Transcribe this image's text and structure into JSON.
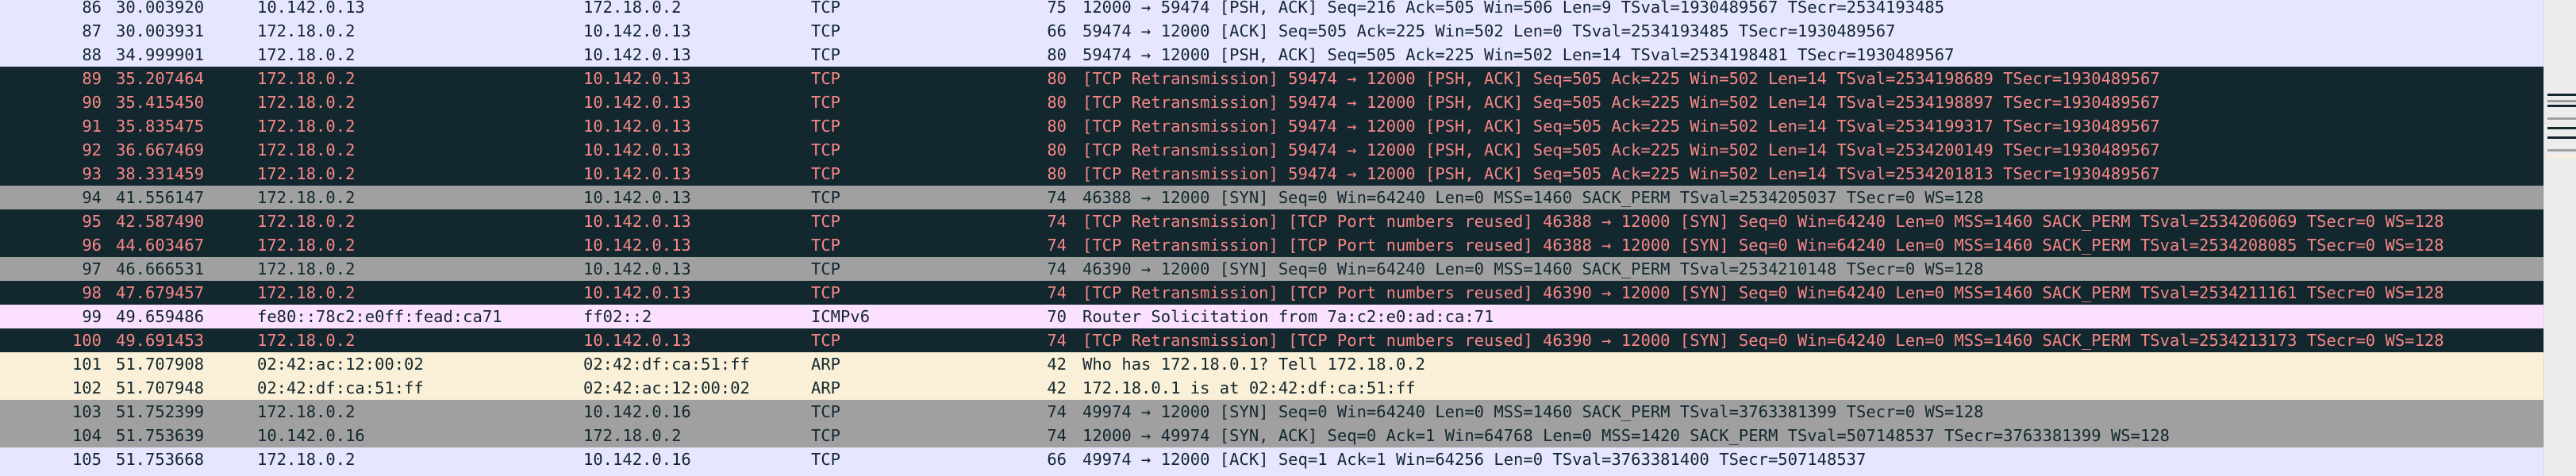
{
  "packets": [
    {
      "no": "86",
      "time": "30.003920",
      "src": "10.142.0.13",
      "dst": "172.18.0.2",
      "proto": "TCP",
      "len": "75",
      "info": "12000 → 59474 [PSH, ACK] Seq=216 Ack=505 Win=506 Len=9 TSval=1930489567 TSecr=2534193485",
      "style": "tcp"
    },
    {
      "no": "87",
      "time": "30.003931",
      "src": "172.18.0.2",
      "dst": "10.142.0.13",
      "proto": "TCP",
      "len": "66",
      "info": "59474 → 12000 [ACK] Seq=505 Ack=225 Win=502 Len=0 TSval=2534193485 TSecr=1930489567",
      "style": "tcp"
    },
    {
      "no": "88",
      "time": "34.999901",
      "src": "172.18.0.2",
      "dst": "10.142.0.13",
      "proto": "TCP",
      "len": "80",
      "info": "59474 → 12000 [PSH, ACK] Seq=505 Ack=225 Win=502 Len=14 TSval=2534198481 TSecr=1930489567",
      "style": "tcp"
    },
    {
      "no": "89",
      "time": "35.207464",
      "src": "172.18.0.2",
      "dst": "10.142.0.13",
      "proto": "TCP",
      "len": "80",
      "info": "[TCP Retransmission] 59474 → 12000 [PSH, ACK] Seq=505 Ack=225 Win=502 Len=14 TSval=2534198689 TSecr=1930489567",
      "style": "bad"
    },
    {
      "no": "90",
      "time": "35.415450",
      "src": "172.18.0.2",
      "dst": "10.142.0.13",
      "proto": "TCP",
      "len": "80",
      "info": "[TCP Retransmission] 59474 → 12000 [PSH, ACK] Seq=505 Ack=225 Win=502 Len=14 TSval=2534198897 TSecr=1930489567",
      "style": "bad"
    },
    {
      "no": "91",
      "time": "35.835475",
      "src": "172.18.0.2",
      "dst": "10.142.0.13",
      "proto": "TCP",
      "len": "80",
      "info": "[TCP Retransmission] 59474 → 12000 [PSH, ACK] Seq=505 Ack=225 Win=502 Len=14 TSval=2534199317 TSecr=1930489567",
      "style": "bad"
    },
    {
      "no": "92",
      "time": "36.667469",
      "src": "172.18.0.2",
      "dst": "10.142.0.13",
      "proto": "TCP",
      "len": "80",
      "info": "[TCP Retransmission] 59474 → 12000 [PSH, ACK] Seq=505 Ack=225 Win=502 Len=14 TSval=2534200149 TSecr=1930489567",
      "style": "bad"
    },
    {
      "no": "93",
      "time": "38.331459",
      "src": "172.18.0.2",
      "dst": "10.142.0.13",
      "proto": "TCP",
      "len": "80",
      "info": "[TCP Retransmission] 59474 → 12000 [PSH, ACK] Seq=505 Ack=225 Win=502 Len=14 TSval=2534201813 TSecr=1930489567",
      "style": "bad"
    },
    {
      "no": "94",
      "time": "41.556147",
      "src": "172.18.0.2",
      "dst": "10.142.0.13",
      "proto": "TCP",
      "len": "74",
      "info": "46388 → 12000 [SYN] Seq=0 Win=64240 Len=0 MSS=1460 SACK_PERM TSval=2534205037 TSecr=0 WS=128",
      "style": "gray"
    },
    {
      "no": "95",
      "time": "42.587490",
      "src": "172.18.0.2",
      "dst": "10.142.0.13",
      "proto": "TCP",
      "len": "74",
      "info": "[TCP Retransmission] [TCP Port numbers reused] 46388 → 12000 [SYN] Seq=0 Win=64240 Len=0 MSS=1460 SACK_PERM TSval=2534206069 TSecr=0 WS=128",
      "style": "bad"
    },
    {
      "no": "96",
      "time": "44.603467",
      "src": "172.18.0.2",
      "dst": "10.142.0.13",
      "proto": "TCP",
      "len": "74",
      "info": "[TCP Retransmission] [TCP Port numbers reused] 46388 → 12000 [SYN] Seq=0 Win=64240 Len=0 MSS=1460 SACK_PERM TSval=2534208085 TSecr=0 WS=128",
      "style": "bad"
    },
    {
      "no": "97",
      "time": "46.666531",
      "src": "172.18.0.2",
      "dst": "10.142.0.13",
      "proto": "TCP",
      "len": "74",
      "info": "46390 → 12000 [SYN] Seq=0 Win=64240 Len=0 MSS=1460 SACK_PERM TSval=2534210148 TSecr=0 WS=128",
      "style": "gray"
    },
    {
      "no": "98",
      "time": "47.679457",
      "src": "172.18.0.2",
      "dst": "10.142.0.13",
      "proto": "TCP",
      "len": "74",
      "info": "[TCP Retransmission] [TCP Port numbers reused] 46390 → 12000 [SYN] Seq=0 Win=64240 Len=0 MSS=1460 SACK_PERM TSval=2534211161 TSecr=0 WS=128",
      "style": "bad"
    },
    {
      "no": "99",
      "time": "49.659486",
      "src": "fe80::78c2:e0ff:fead:ca71",
      "dst": "ff02::2",
      "proto": "ICMPv6",
      "len": "70",
      "info": "Router Solicitation from 7a:c2:e0:ad:ca:71",
      "style": "icmp"
    },
    {
      "no": "100",
      "time": "49.691453",
      "src": "172.18.0.2",
      "dst": "10.142.0.13",
      "proto": "TCP",
      "len": "74",
      "info": "[TCP Retransmission] [TCP Port numbers reused] 46390 → 12000 [SYN] Seq=0 Win=64240 Len=0 MSS=1460 SACK_PERM TSval=2534213173 TSecr=0 WS=128",
      "style": "bad"
    },
    {
      "no": "101",
      "time": "51.707908",
      "src": "02:42:ac:12:00:02",
      "dst": "02:42:df:ca:51:ff",
      "proto": "ARP",
      "len": "42",
      "info": "Who has 172.18.0.1? Tell 172.18.0.2",
      "style": "arp"
    },
    {
      "no": "102",
      "time": "51.707948",
      "src": "02:42:df:ca:51:ff",
      "dst": "02:42:ac:12:00:02",
      "proto": "ARP",
      "len": "42",
      "info": "172.18.0.1 is at 02:42:df:ca:51:ff",
      "style": "arp"
    },
    {
      "no": "103",
      "time": "51.752399",
      "src": "172.18.0.2",
      "dst": "10.142.0.16",
      "proto": "TCP",
      "len": "74",
      "info": "49974 → 12000 [SYN] Seq=0 Win=64240 Len=0 MSS=1460 SACK_PERM TSval=3763381399 TSecr=0 WS=128",
      "style": "gray"
    },
    {
      "no": "104",
      "time": "51.753639",
      "src": "10.142.0.16",
      "dst": "172.18.0.2",
      "proto": "TCP",
      "len": "74",
      "info": "12000 → 49974 [SYN, ACK] Seq=0 Ack=1 Win=64768 Len=0 MSS=1420 SACK_PERM TSval=507148537 TSecr=3763381399 WS=128",
      "style": "gray"
    },
    {
      "no": "105",
      "time": "51.753668",
      "src": "172.18.0.2",
      "dst": "10.142.0.16",
      "proto": "TCP",
      "len": "66",
      "info": "49974 → 12000 [ACK] Seq=1 Ack=1 Win=64256 Len=0 TSval=3763381400 TSecr=507148537",
      "style": "tcp"
    }
  ],
  "colors": {
    "tcp_bg": "#e7e6ff",
    "bad_bg": "#12272e",
    "bad_fg": "#f78787",
    "gray_bg": "#a0a0a0",
    "icmp_bg": "#fce0ff",
    "arp_bg": "#faf0d7",
    "text": "#12272e"
  }
}
